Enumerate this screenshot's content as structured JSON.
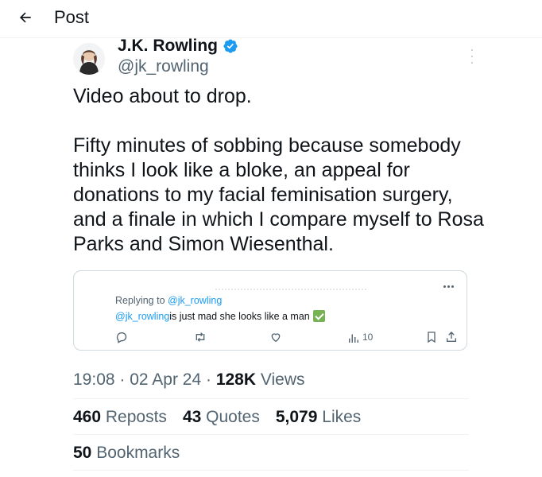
{
  "header": {
    "title": "Post"
  },
  "author": {
    "name": "J.K. Rowling",
    "handle": "@jk_rowling"
  },
  "tweet": {
    "text": "Video about to drop.\n\nFifty minutes of sobbing because somebody thinks I look like a bloke, an appeal for donations to my facial feminisation surgery, and a finale in which I compare myself to Rosa Parks and Simon Wiesenthal."
  },
  "quoted": {
    "replying_prefix": "Replying to ",
    "replying_handle": "@jk_rowling",
    "mention": "@jk_rowling",
    "text": " is just mad she looks like a man",
    "views_count": "10"
  },
  "meta": {
    "time": "19:08",
    "date": "02 Apr 24",
    "views_count": "128K",
    "views_label": "Views",
    "separator": " · "
  },
  "stats": {
    "reposts_count": "460",
    "reposts_label": "Reposts",
    "quotes_count": "43",
    "quotes_label": "Quotes",
    "likes_count": "5,079",
    "likes_label": "Likes",
    "bookmarks_count": "50",
    "bookmarks_label": "Bookmarks"
  },
  "colors": {
    "accent": "#1d9bf0",
    "text": "#0f1419",
    "muted": "#536471",
    "border": "#cfd9de"
  },
  "icons": [
    "back-arrow-icon",
    "verified-badge-icon",
    "more-vertical-icon",
    "more-horizontal-icon",
    "reply-icon",
    "repost-icon",
    "like-icon",
    "views-icon",
    "bookmark-icon",
    "share-icon",
    "checkmark-emoji-icon"
  ]
}
